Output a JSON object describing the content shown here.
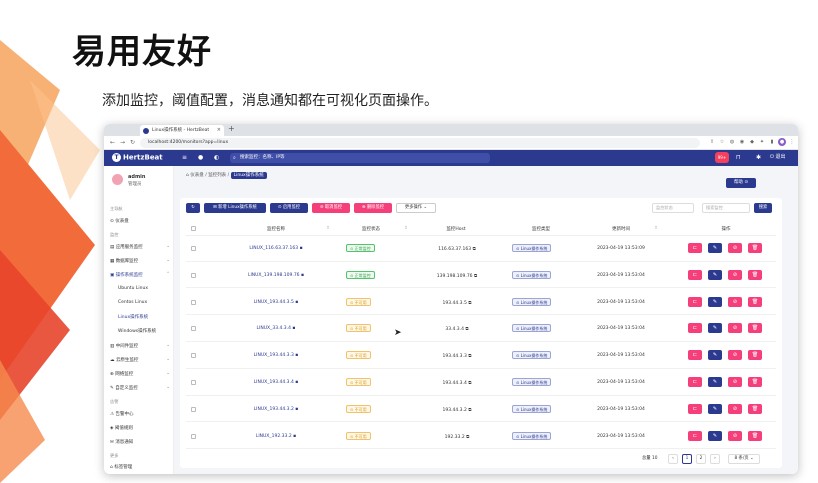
{
  "slide": {
    "title": "易用友好",
    "subtitle": "添加监控，阈值配置，消息通知都在可视化页面操作。"
  },
  "browser": {
    "tab_title": "Linux操作系统 - HertzBeat",
    "url": "localhost:4200/monitors?app=linux",
    "add_tab": "+",
    "close_tab": "×"
  },
  "header": {
    "logo": "HertzBeat",
    "search_placeholder": "搜索监控：名称、IP等",
    "notif_count": "99+",
    "logout": "退出"
  },
  "sidebar": {
    "user_name": "admin",
    "user_role": "管理员",
    "groups": {
      "home": "主导航",
      "monitor": "监控",
      "alert": "告警",
      "more": "更多"
    },
    "items": {
      "dashboard": "仪表盘",
      "app_monitor": "应用服务监控",
      "db_monitor": "数据库监控",
      "os_monitor": "操作系统监控",
      "ubuntu": "Ubuntu Linux",
      "centos": "Centos Linux",
      "linux": "Linux操作系统",
      "windows": "Windows操作系统",
      "middleware": "中间件监控",
      "cloud": "云原生监控",
      "network": "网络监控",
      "custom": "自定义监控",
      "alert_center": "告警中心",
      "threshold": "阈值规则",
      "notify": "消息通知",
      "tags": "标签管理"
    }
  },
  "breadcrumb": {
    "home": "仪表盘",
    "list": "监控列表",
    "current": "Linux操作系统"
  },
  "toolbar": {
    "refresh": "↻",
    "add": "新增 Linux操作系统",
    "enable": "启用监控",
    "cancel": "取消监控",
    "delete": "删除监控",
    "more": "更多操作",
    "filter1_placeholder": "监控状态",
    "filter2_placeholder": "搜索监控",
    "search": "搜索",
    "help": "帮助"
  },
  "table": {
    "columns": [
      "监控名称",
      "监控状态",
      "监控Host",
      "监控类型",
      "更新时间",
      "操作"
    ],
    "rows": [
      {
        "name": "LINUX_116.63.37.163",
        "status": "正常监控",
        "status_type": "ok",
        "host": "116.63.37.163",
        "type": "Linux操作系统",
        "time": "2023-04-19 13:53:09"
      },
      {
        "name": "LINUX_139.198.109.76",
        "status": "正常监控",
        "status_type": "ok",
        "host": "139.198.109.76",
        "type": "Linux操作系统",
        "time": "2023-04-19 13:53:04"
      },
      {
        "name": "LINUX_193.44.3.5",
        "status": "不可用",
        "status_type": "warn",
        "host": "193.44.3.5",
        "type": "Linux操作系统",
        "time": "2023-04-19 13:53:04"
      },
      {
        "name": "LINUX_33.4.3.4",
        "status": "不可用",
        "status_type": "warn",
        "host": "33.4.3.4",
        "type": "Linux操作系统",
        "time": "2023-04-19 13:53:04"
      },
      {
        "name": "LINUX_193.44.3.3",
        "status": "不可用",
        "status_type": "warn",
        "host": "193.44.3.3",
        "type": "Linux操作系统",
        "time": "2023-04-19 13:53:04"
      },
      {
        "name": "LINUX_193.44.3.4",
        "status": "不可用",
        "status_type": "warn",
        "host": "193.44.3.4",
        "type": "Linux操作系统",
        "time": "2023-04-19 13:53:04"
      },
      {
        "name": "LINUX_193.44.3.2",
        "status": "不可用",
        "status_type": "warn",
        "host": "193.44.3.2",
        "type": "Linux操作系统",
        "time": "2023-04-19 13:53:04"
      },
      {
        "name": "LINUX_192.33.2",
        "status": "不可用",
        "status_type": "warn",
        "host": "192.33.2",
        "type": "Linux操作系统",
        "time": "2023-04-19 13:53:04"
      }
    ]
  },
  "pagination": {
    "total": "总量 10",
    "prev": "‹",
    "page1": "1",
    "page2": "2",
    "next": "›",
    "page_size": "8 条/页"
  },
  "colors": {
    "brand": "#2b3a8f",
    "danger": "#f53f7a",
    "ok": "#3aa552",
    "warn": "#d9960d"
  }
}
